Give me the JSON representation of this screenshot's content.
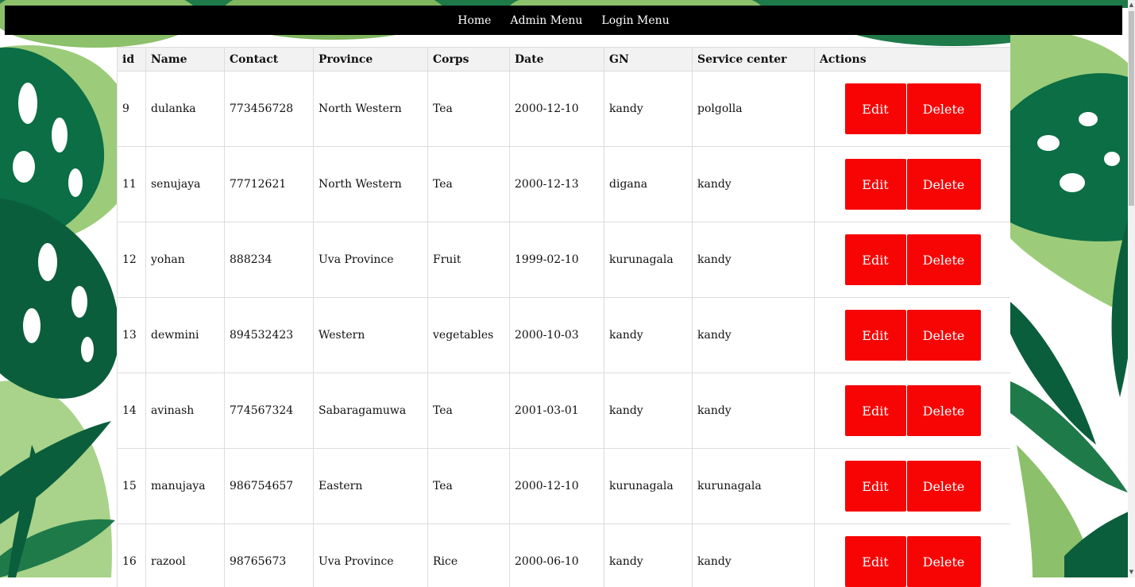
{
  "nav": {
    "items": [
      "Home",
      "Admin Menu",
      "Login Menu"
    ]
  },
  "table": {
    "headers": [
      "id",
      "Name",
      "Contact",
      "Province",
      "Corps",
      "Date",
      "GN",
      "Service center",
      "Actions"
    ],
    "rows": [
      [
        "9",
        "dulanka",
        "773456728",
        "North Western",
        "Tea",
        "2000-12-10",
        "kandy",
        "polgolla"
      ],
      [
        "11",
        "senujaya",
        "77712621",
        "North Western",
        "Tea",
        "2000-12-13",
        "digana",
        "kandy"
      ],
      [
        "12",
        "yohan",
        "888234",
        "Uva Province",
        "Fruit",
        "1999-02-10",
        "kurunagala",
        "kandy"
      ],
      [
        "13",
        "dewmini",
        "894532423",
        "Western",
        "vegetables",
        "2000-10-03",
        "kandy",
        "kandy"
      ],
      [
        "14",
        "avinash",
        "774567324",
        "Sabaragamuwa",
        "Tea",
        "2001-03-01",
        "kandy",
        "kandy"
      ],
      [
        "15",
        "manujaya",
        "986754657",
        "Eastern",
        "Tea",
        "2000-12-10",
        "kurunagala",
        "kurunagala"
      ],
      [
        "16",
        "razool",
        "98765673",
        "Uva Province",
        "Rice",
        "2000-06-10",
        "kandy",
        "kandy"
      ]
    ],
    "edit_label": "Edit",
    "delete_label": "Delete"
  },
  "colors": {
    "navbar": "#000000",
    "button": "#f70505",
    "leaf_dark": "#0b5e3c",
    "leaf_mid": "#1f7a4a",
    "leaf_light": "#8cc06a"
  }
}
